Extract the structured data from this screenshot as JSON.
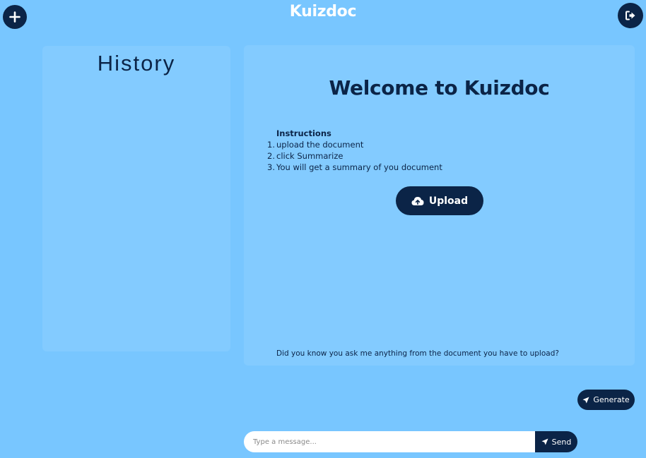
{
  "header": {
    "title": "Kuizdoc",
    "new_icon": "plus-icon",
    "logout_icon": "logout-icon"
  },
  "history": {
    "title": "History"
  },
  "main": {
    "welcome": "Welcome to Kuizdoc",
    "instructions": {
      "title": "Instructions",
      "steps": [
        {
          "num": "1.",
          "text": "upload the document"
        },
        {
          "num": "2.",
          "text": "click Summarize"
        },
        {
          "num": "3.",
          "text": "You will get a summary of you document"
        }
      ]
    },
    "upload": {
      "label": "Upload",
      "icon": "cloud-upload-icon"
    },
    "tip": "Did you know you ask me anything from the document you have to upload?"
  },
  "generate": {
    "label": "Generate",
    "icon": "send-arrow-icon"
  },
  "chat": {
    "placeholder": "Type a message...",
    "value": "",
    "send_label": "Send",
    "send_icon": "send-arrow-icon"
  },
  "colors": {
    "background": "#78c6ff",
    "panel": "#83cbff",
    "navy": "#0b2447",
    "white": "#ffffff"
  }
}
